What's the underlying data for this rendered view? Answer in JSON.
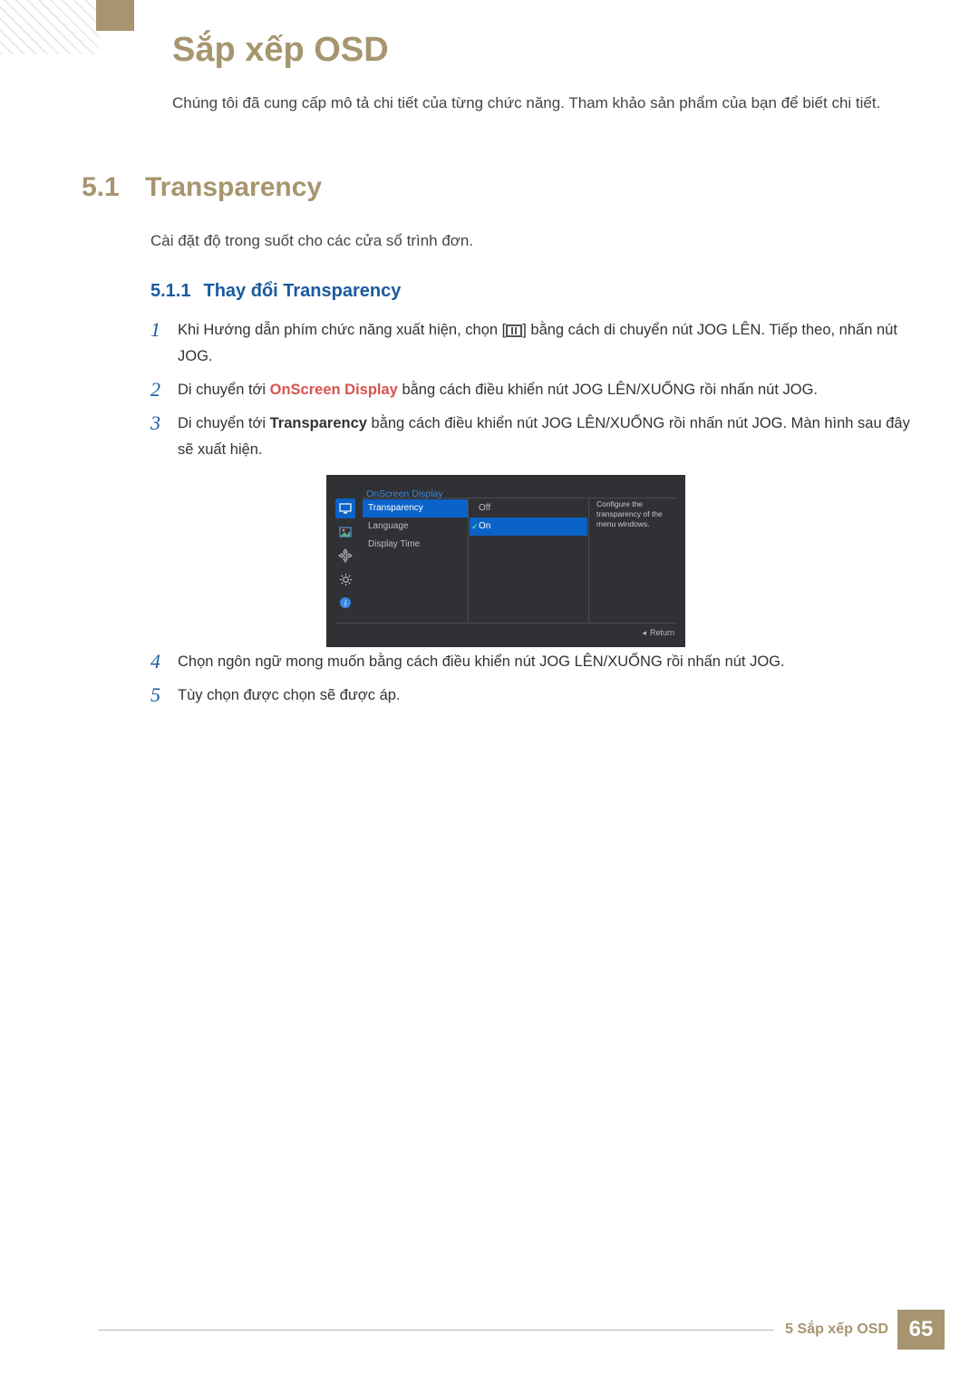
{
  "page": {
    "title": "Sắp xếp OSD",
    "intro": "Chúng tôi đã cung cấp mô tả chi tiết của từng chức năng. Tham khảo sản phẩm của bạn để biết chi tiết."
  },
  "section": {
    "num": "5.1",
    "title": "Transparency",
    "desc": "Cài đặt độ trong suốt cho các cửa sổ trình đơn."
  },
  "subsection": {
    "num": "5.1.1",
    "title": "Thay đổi Transparency"
  },
  "steps": {
    "s1_a": "Khi Hướng dẫn phím chức năng xuất hiện, chọn [",
    "s1_b": "] bằng cách di chuyển nút JOG LÊN. Tiếp theo, nhấn nút JOG.",
    "s2_a": "Di chuyển tới ",
    "s2_hl": "OnScreen Display",
    "s2_b": " bằng cách điều khiển nút JOG LÊN/XUỐNG rồi nhấn nút JOG.",
    "s3_a": "Di chuyển tới ",
    "s3_bold": "Transparency",
    "s3_b": " bằng cách điều khiển nút JOG LÊN/XUỐNG rồi nhấn nút JOG. Màn hình sau đây sẽ xuất hiện.",
    "s4": "Chọn ngôn ngữ mong muốn bằng cách điều khiển nút JOG LÊN/XUỐNG rồi nhấn nút JOG.",
    "s5": "Tùy chọn được chọn sẽ được áp."
  },
  "nums": {
    "n1": "1",
    "n2": "2",
    "n3": "3",
    "n4": "4",
    "n5": "5"
  },
  "osd": {
    "header": "OnScreen Display",
    "menu": {
      "transparency": "Transparency",
      "language": "Language",
      "displayTime": "Display Time"
    },
    "values": {
      "off": "Off",
      "on": "On"
    },
    "desc": "Configure the transparency of the menu windows.",
    "return": "Return"
  },
  "footer": {
    "label": "5 Sắp xếp OSD",
    "page": "65"
  }
}
